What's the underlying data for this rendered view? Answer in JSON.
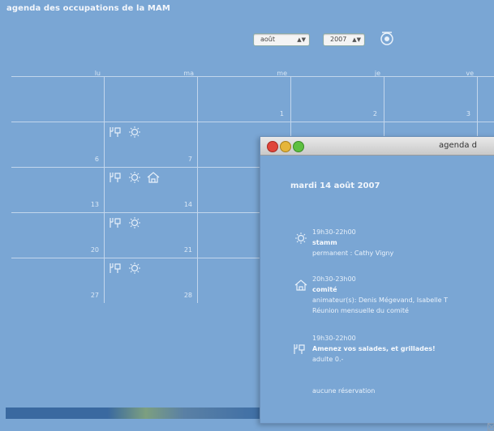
{
  "page": {
    "title": "agenda des occupations de la MAM"
  },
  "controls": {
    "month": "août",
    "year": "2007"
  },
  "calendar": {
    "day_headers": [
      "lu",
      "ma",
      "me",
      "je",
      "ve"
    ],
    "day_numbers": [
      "1",
      "2",
      "3",
      "6",
      "7",
      "13",
      "14",
      "20",
      "21",
      "27",
      "28"
    ]
  },
  "popup": {
    "window_title": "agenda d",
    "date_heading": "mardi 14 août 2007",
    "events": [
      {
        "time": "19h30-22h00",
        "name": "stamm",
        "detail1": "permanent : Cathy Vigny",
        "detail2": "",
        "icon": "sun-icon"
      },
      {
        "time": "20h30-23h00",
        "name": "comité",
        "detail1": "animateur(s): Denis Mégevand, Isabelle T",
        "detail2": "Réunion mensuelle du comité",
        "icon": "house-icon"
      },
      {
        "time": "19h30-22h00",
        "name": "Amenez vos salades, et grillades!",
        "detail1": "adulte 0.-",
        "detail2": "",
        "icon": "dining-icon"
      }
    ],
    "no_reservation": "aucune réservation"
  }
}
